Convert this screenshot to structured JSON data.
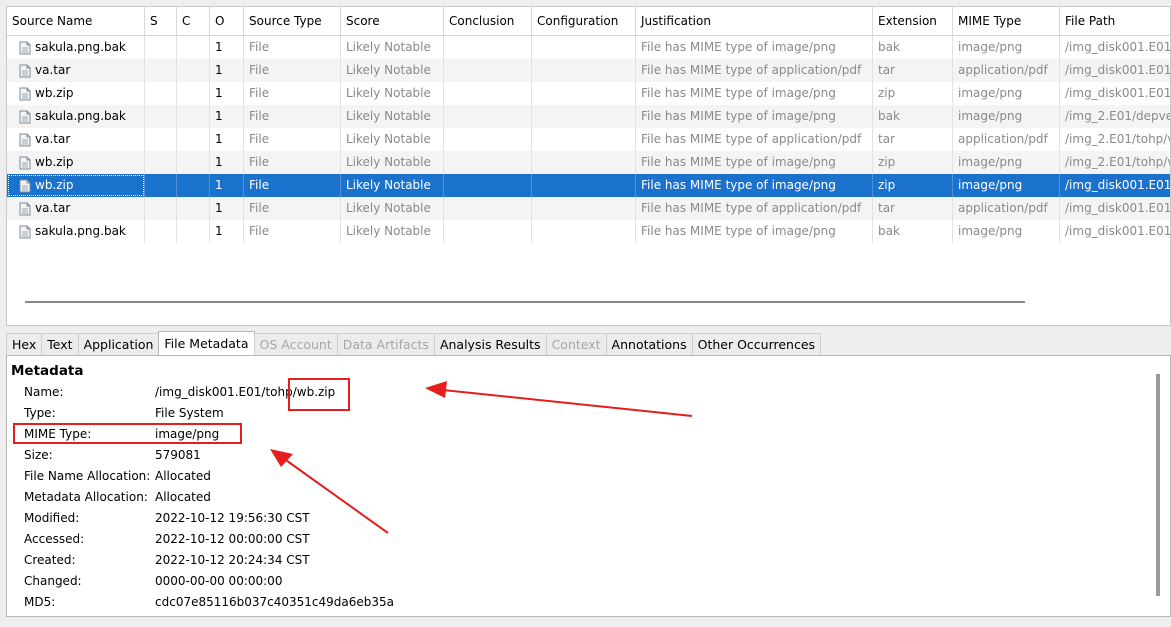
{
  "columns": [
    "Source Name",
    "S",
    "C",
    "O",
    "Source Type",
    "Score",
    "Conclusion",
    "Configuration",
    "Justification",
    "Extension",
    "MIME Type",
    "File Path"
  ],
  "rows": [
    {
      "name": "sakula.png.bak",
      "s": "",
      "c": "",
      "o": "1",
      "type": "File",
      "score": "Likely Notable",
      "conclusion": "",
      "configuration": "",
      "justification": "File has MIME type of image/png",
      "ext": "bak",
      "mime": "image/png",
      "path": "/img_disk001.E01/"
    },
    {
      "name": "va.tar",
      "s": "",
      "c": "",
      "o": "1",
      "type": "File",
      "score": "Likely Notable",
      "conclusion": "",
      "configuration": "",
      "justification": "File has MIME type of application/pdf",
      "ext": "tar",
      "mime": "application/pdf",
      "path": "/img_disk001.E01/"
    },
    {
      "name": "wb.zip",
      "s": "",
      "c": "",
      "o": "1",
      "type": "File",
      "score": "Likely Notable",
      "conclusion": "",
      "configuration": "",
      "justification": "File has MIME type of image/png",
      "ext": "zip",
      "mime": "image/png",
      "path": "/img_disk001.E01/"
    },
    {
      "name": "sakula.png.bak",
      "s": "",
      "c": "",
      "o": "1",
      "type": "File",
      "score": "Likely Notable",
      "conclusion": "",
      "configuration": "",
      "justification": "File has MIME type of image/png",
      "ext": "bak",
      "mime": "image/png",
      "path": "/img_2.E01/depvel"
    },
    {
      "name": "va.tar",
      "s": "",
      "c": "",
      "o": "1",
      "type": "File",
      "score": "Likely Notable",
      "conclusion": "",
      "configuration": "",
      "justification": "File has MIME type of application/pdf",
      "ext": "tar",
      "mime": "application/pdf",
      "path": "/img_2.E01/tohp/v"
    },
    {
      "name": "wb.zip",
      "s": "",
      "c": "",
      "o": "1",
      "type": "File",
      "score": "Likely Notable",
      "conclusion": "",
      "configuration": "",
      "justification": "File has MIME type of image/png",
      "ext": "zip",
      "mime": "image/png",
      "path": "/img_2.E01/tohp/v"
    },
    {
      "name": "wb.zip",
      "s": "",
      "c": "",
      "o": "1",
      "type": "File",
      "score": "Likely Notable",
      "conclusion": "",
      "configuration": "",
      "justification": "File has MIME type of image/png",
      "ext": "zip",
      "mime": "image/png",
      "path": "/img_disk001.E01/",
      "selected": true
    },
    {
      "name": "va.tar",
      "s": "",
      "c": "",
      "o": "1",
      "type": "File",
      "score": "Likely Notable",
      "conclusion": "",
      "configuration": "",
      "justification": "File has MIME type of application/pdf",
      "ext": "tar",
      "mime": "application/pdf",
      "path": "/img_disk001.E01/"
    },
    {
      "name": "sakula.png.bak",
      "s": "",
      "c": "",
      "o": "1",
      "type": "File",
      "score": "Likely Notable",
      "conclusion": "",
      "configuration": "",
      "justification": "File has MIME type of image/png",
      "ext": "bak",
      "mime": "image/png",
      "path": "/img_disk001.E01/"
    }
  ],
  "tabs": [
    {
      "label": "Hex",
      "state": "normal"
    },
    {
      "label": "Text",
      "state": "normal"
    },
    {
      "label": "Application",
      "state": "normal"
    },
    {
      "label": "File Metadata",
      "state": "active"
    },
    {
      "label": "OS Account",
      "state": "disabled"
    },
    {
      "label": "Data Artifacts",
      "state": "disabled"
    },
    {
      "label": "Analysis Results",
      "state": "normal"
    },
    {
      "label": "Context",
      "state": "disabled"
    },
    {
      "label": "Annotations",
      "state": "normal"
    },
    {
      "label": "Other Occurrences",
      "state": "normal"
    }
  ],
  "metadata": {
    "title": "Metadata",
    "name_prefix": "/img_disk001.E01/tohp/",
    "name_file": "wb.zip",
    "fields": [
      {
        "label": "Type:",
        "value": "File System"
      },
      {
        "label": "MIME Type:",
        "value": "image/png"
      },
      {
        "label": "Size:",
        "value": "579081"
      },
      {
        "label": "File Name Allocation:",
        "value": "Allocated"
      },
      {
        "label": "Metadata Allocation:",
        "value": "Allocated"
      },
      {
        "label": "Modified:",
        "value": "2022-10-12 19:56:30 CST"
      },
      {
        "label": "Accessed:",
        "value": "2022-10-12 00:00:00 CST"
      },
      {
        "label": "Created:",
        "value": "2022-10-12 20:24:34 CST"
      },
      {
        "label": "Changed:",
        "value": "0000-00-00 00:00:00"
      },
      {
        "label": "MD5:",
        "value": "cdc07e85116b037c40351c49da6eb35a"
      }
    ],
    "name_label": "Name:"
  },
  "colors": {
    "selection": "#1a72cc",
    "annotation": "#e51d1d"
  }
}
